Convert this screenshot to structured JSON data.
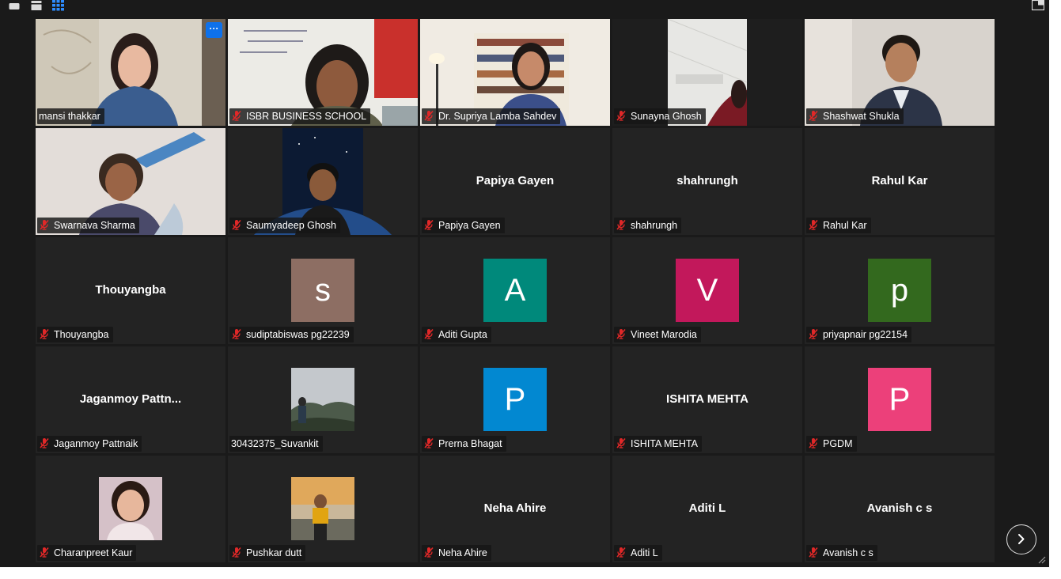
{
  "toolbar": {
    "icons": [
      "minimize-icon",
      "speaker-view-icon",
      "gallery-view-icon",
      "exit-fullscreen-icon"
    ]
  },
  "more_button_label": "···",
  "participants": [
    {
      "name": "mansi thakkar",
      "muted": false,
      "display": "video",
      "active_speaker": true,
      "scene": "woman-speaking"
    },
    {
      "name": "ISBR BUSINESS SCHOOL",
      "muted": true,
      "display": "video",
      "scene": "woman-whiteboard"
    },
    {
      "name": "Dr. Supriya Lamba Sahdev",
      "muted": true,
      "display": "video",
      "scene": "woman-bookshelf"
    },
    {
      "name": "Sunayna Ghosh",
      "muted": true,
      "display": "video",
      "scene": "ceiling-room"
    },
    {
      "name": "Shashwat Shukla",
      "muted": true,
      "display": "video",
      "scene": "man-suit"
    },
    {
      "name": "Swarnava Sharma",
      "muted": true,
      "display": "video",
      "scene": "person-room"
    },
    {
      "name": "Saumyadeep Ghosh",
      "muted": true,
      "display": "photo",
      "scene": "man-space"
    },
    {
      "name": "Papiya Gayen",
      "center_text": "Papiya Gayen",
      "muted": true,
      "display": "name"
    },
    {
      "name": "shahrungh",
      "center_text": "shahrungh",
      "muted": true,
      "display": "name"
    },
    {
      "name": "Rahul Kar",
      "center_text": "Rahul Kar",
      "muted": true,
      "display": "name"
    },
    {
      "name": "Thouyangba",
      "center_text": "Thouyangba",
      "muted": true,
      "display": "name"
    },
    {
      "name": "sudiptabiswas pg22239",
      "avatar_letter": "s",
      "avatar_color": "#8d6e63",
      "muted": true,
      "display": "avatar"
    },
    {
      "name": "Aditi Gupta",
      "avatar_letter": "A",
      "avatar_color": "#00897b",
      "muted": true,
      "display": "avatar"
    },
    {
      "name": "Vineet Marodia",
      "avatar_letter": "V",
      "avatar_color": "#c2185b",
      "muted": true,
      "display": "avatar"
    },
    {
      "name": "priyapnair pg22154",
      "avatar_letter": "p",
      "avatar_color": "#33691e",
      "muted": true,
      "display": "avatar"
    },
    {
      "name": "Jaganmoy Pattnaik",
      "center_text": "Jaganmoy  Pattn...",
      "muted": true,
      "display": "name"
    },
    {
      "name": "30432375_Suvankit",
      "muted": false,
      "display": "photo",
      "scene": "misty-hills"
    },
    {
      "name": "Prerna Bhagat",
      "avatar_letter": "P",
      "avatar_color": "#0288d1",
      "muted": true,
      "display": "avatar"
    },
    {
      "name": "ISHITA MEHTA",
      "center_text": "ISHITA MEHTA",
      "muted": true,
      "display": "name"
    },
    {
      "name": "PGDM",
      "avatar_letter": "P",
      "avatar_color": "#ec407a",
      "muted": true,
      "display": "avatar"
    },
    {
      "name": "Charanpreet Kaur",
      "muted": true,
      "display": "photo",
      "scene": "woman-portrait"
    },
    {
      "name": "Pushkar dutt",
      "muted": true,
      "display": "photo",
      "scene": "man-sunset"
    },
    {
      "name": "Neha Ahire",
      "center_text": "Neha Ahire",
      "muted": true,
      "display": "name"
    },
    {
      "name": "Aditi L",
      "center_text": "Aditi L",
      "muted": true,
      "display": "name"
    },
    {
      "name": "Avanish c s",
      "center_text": "Avanish c s",
      "muted": true,
      "display": "name"
    }
  ],
  "pagination": {
    "next_icon": "chevron-right-icon"
  },
  "colors": {
    "background": "#1a1a1a",
    "tile": "#232323",
    "active_border": "#e7e56a",
    "mute_red": "#e02828",
    "more_button": "#0e71eb"
  }
}
